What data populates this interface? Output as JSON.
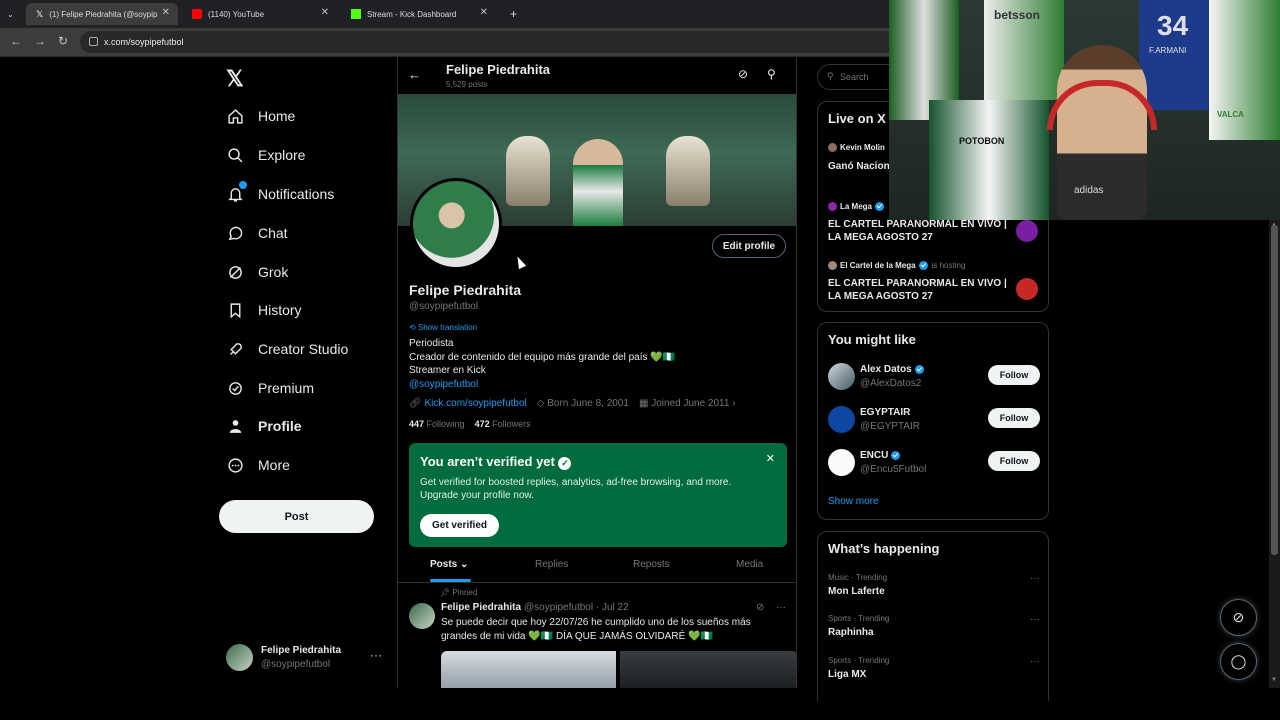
{
  "browser": {
    "tabs": [
      {
        "title": "(1) Felipe Piedrahita (@soypip",
        "active": true
      },
      {
        "title": "(1140) YouTube",
        "active": false
      },
      {
        "title": "Stream - Kick Dashboard",
        "active": false
      }
    ],
    "url": "x.com/soypipefutbol",
    "new_tab": "+"
  },
  "nav": {
    "logo": "𝕏",
    "items": [
      {
        "label": "Home",
        "icon": "home-icon"
      },
      {
        "label": "Explore",
        "icon": "search-icon"
      },
      {
        "label": "Notifications",
        "icon": "bell-icon"
      },
      {
        "label": "Chat",
        "icon": "chat-bubble-icon"
      },
      {
        "label": "Grok",
        "icon": "grok-icon"
      },
      {
        "label": "History",
        "icon": "bookmark-icon"
      },
      {
        "label": "Creator Studio",
        "icon": "rocket-icon"
      },
      {
        "label": "Premium",
        "icon": "verified-badge-icon"
      },
      {
        "label": "Profile",
        "icon": "person-icon"
      },
      {
        "label": "More",
        "icon": "more-circle-icon"
      }
    ],
    "post_label": "Post",
    "account": {
      "name": "Felipe Piedrahita",
      "handle": "@soypipefutbol",
      "more": "···"
    }
  },
  "profile_header": {
    "back": "←",
    "title": "Felipe Piedrahita",
    "posts_count": "5,529 posts"
  },
  "profile": {
    "edit_label": "Edit profile",
    "name": "Felipe Piedrahita",
    "handle": "@soypipefutbol",
    "show_translation": "Show translation",
    "bio_lines": [
      "Periodista",
      "Creador de contenido del equipo más grande del país 💚🇳🇬",
      "Streamer en Kick"
    ],
    "bio_link": "@soypipefutbol",
    "website": "Kick.com/soypipefutbol",
    "born": "Born June 8, 2001",
    "joined": "Joined June 2011",
    "following_count": "447",
    "following_label": "Following",
    "followers_count": "472",
    "followers_label": "Followers"
  },
  "verification": {
    "title": "You aren’t verified yet",
    "description": "Get verified for boosted replies, analytics, ad-free browsing, and more. Upgrade your profile now.",
    "button": "Get verified",
    "close": "✕"
  },
  "profile_tabs": [
    "Posts",
    "Replies",
    "Reposts",
    "Media"
  ],
  "pinned_tweet": {
    "pinned_label": "Pinned",
    "name": "Felipe Piedrahita",
    "handle_date": "@soypipefutbol · Jul 22",
    "text": "Se puede decir que hoy 22/07/26 he cumplido uno de los sueños más grandes de mi vida 💚🇳🇬 DÍA QUE JAMÁS OLVIDARÉ 💚🇳🇬"
  },
  "search": {
    "placeholder": "Search"
  },
  "live": {
    "title": "Live on X",
    "items": [
      {
        "host": "Kevin Molin",
        "verified": false,
        "hosting": "",
        "title": "Ganó Nacion Marlos More",
        "dot": "#8d6e63",
        "thumb": ""
      },
      {
        "host": "La Mega",
        "verified": true,
        "hosting": "",
        "title": "EL CARTEL PARANORMAL EN VIVO | LA MEGA AGOSTO 27",
        "dot": "#8e24aa",
        "thumb": "#7b1fa2"
      },
      {
        "host": "El Cartel de la Mega",
        "verified": true,
        "hosting": "is hosting",
        "title": "EL CARTEL PARANORMAL EN VIVO | LA MEGA AGOSTO 27",
        "dot": "#a1887f",
        "thumb": "#c62828"
      }
    ]
  },
  "suggestions": {
    "title": "You might like",
    "items": [
      {
        "name": "Alex Datos",
        "handle": "@AlexDatos2",
        "verified": true,
        "follow": "Follow"
      },
      {
        "name": "EGYPTAIR",
        "handle": "@EGYPTAIR",
        "verified": false,
        "follow": "Follow"
      },
      {
        "name": "ENCU",
        "handle": "@Encu5Futbol",
        "verified": true,
        "follow": "Follow"
      }
    ],
    "show_more": "Show more"
  },
  "trends": {
    "title": "What’s happening",
    "items": [
      {
        "category": "Music · Trending",
        "name": "Mon Laferte"
      },
      {
        "category": "Sports · Trending",
        "name": "Raphinha"
      },
      {
        "category": "Sports · Trending",
        "name": "Liga MX"
      }
    ],
    "more": "···"
  },
  "webcam": {
    "jersey_texts": [
      "betsson",
      "34",
      "F.ARMANI",
      "POTOBON",
      "adidas",
      "VALCA"
    ]
  },
  "colors": {
    "accent": "#1d9bf0",
    "verify_panel": "#006b3c",
    "background": "#000000"
  }
}
